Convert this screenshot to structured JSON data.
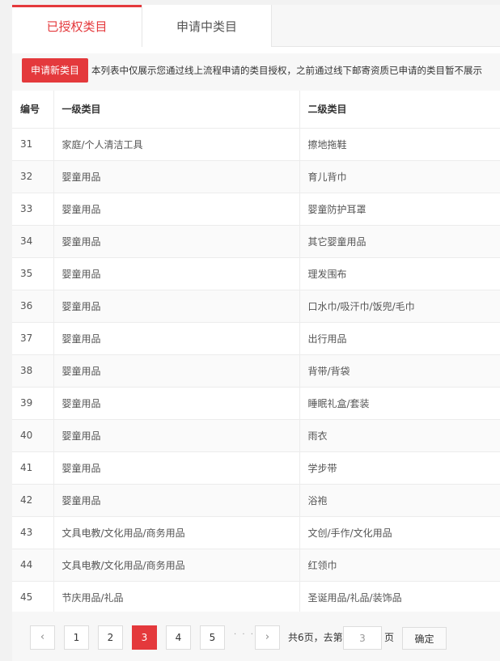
{
  "tabs": [
    {
      "label": "已授权类目",
      "active": true
    },
    {
      "label": "申请中类目",
      "active": false
    }
  ],
  "notice": {
    "apply_button": "申请新类目",
    "text": "本列表中仅展示您通过线上流程申请的类目授权，之前通过线下邮寄资质已申请的类目暂不展示"
  },
  "table": {
    "headers": [
      "编号",
      "一级类目",
      "二级类目"
    ],
    "rows": [
      {
        "id": "31",
        "level1": "家庭/个人清洁工具",
        "level2": "擦地拖鞋"
      },
      {
        "id": "32",
        "level1": "婴童用品",
        "level2": "育儿背巾"
      },
      {
        "id": "33",
        "level1": "婴童用品",
        "level2": "婴童防护耳罩"
      },
      {
        "id": "34",
        "level1": "婴童用品",
        "level2": "其它婴童用品"
      },
      {
        "id": "35",
        "level1": "婴童用品",
        "level2": "理发围布"
      },
      {
        "id": "36",
        "level1": "婴童用品",
        "level2": "口水巾/吸汗巾/饭兜/毛巾"
      },
      {
        "id": "37",
        "level1": "婴童用品",
        "level2": "出行用品"
      },
      {
        "id": "38",
        "level1": "婴童用品",
        "level2": "背带/背袋"
      },
      {
        "id": "39",
        "level1": "婴童用品",
        "level2": "睡眠礼盒/套装"
      },
      {
        "id": "40",
        "level1": "婴童用品",
        "level2": "雨衣"
      },
      {
        "id": "41",
        "level1": "婴童用品",
        "level2": "学步带"
      },
      {
        "id": "42",
        "level1": "婴童用品",
        "level2": "浴袍"
      },
      {
        "id": "43",
        "level1": "文具电教/文化用品/商务用品",
        "level2": "文创/手作/文化用品"
      },
      {
        "id": "44",
        "level1": "文具电教/文化用品/商务用品",
        "level2": "红领巾"
      },
      {
        "id": "45",
        "level1": "节庆用品/礼品",
        "level2": "圣诞用品/礼品/装饰品"
      }
    ]
  },
  "pagination": {
    "prev": "‹",
    "pages": [
      "1",
      "2",
      "3",
      "4",
      "5"
    ],
    "current": "3",
    "ellipsis": "· · ·",
    "next": "›",
    "total_text": "共6页，去第",
    "goto_value": "3",
    "page_suffix": "页",
    "confirm": "确定"
  },
  "colors": {
    "accent": "#e4393c"
  }
}
